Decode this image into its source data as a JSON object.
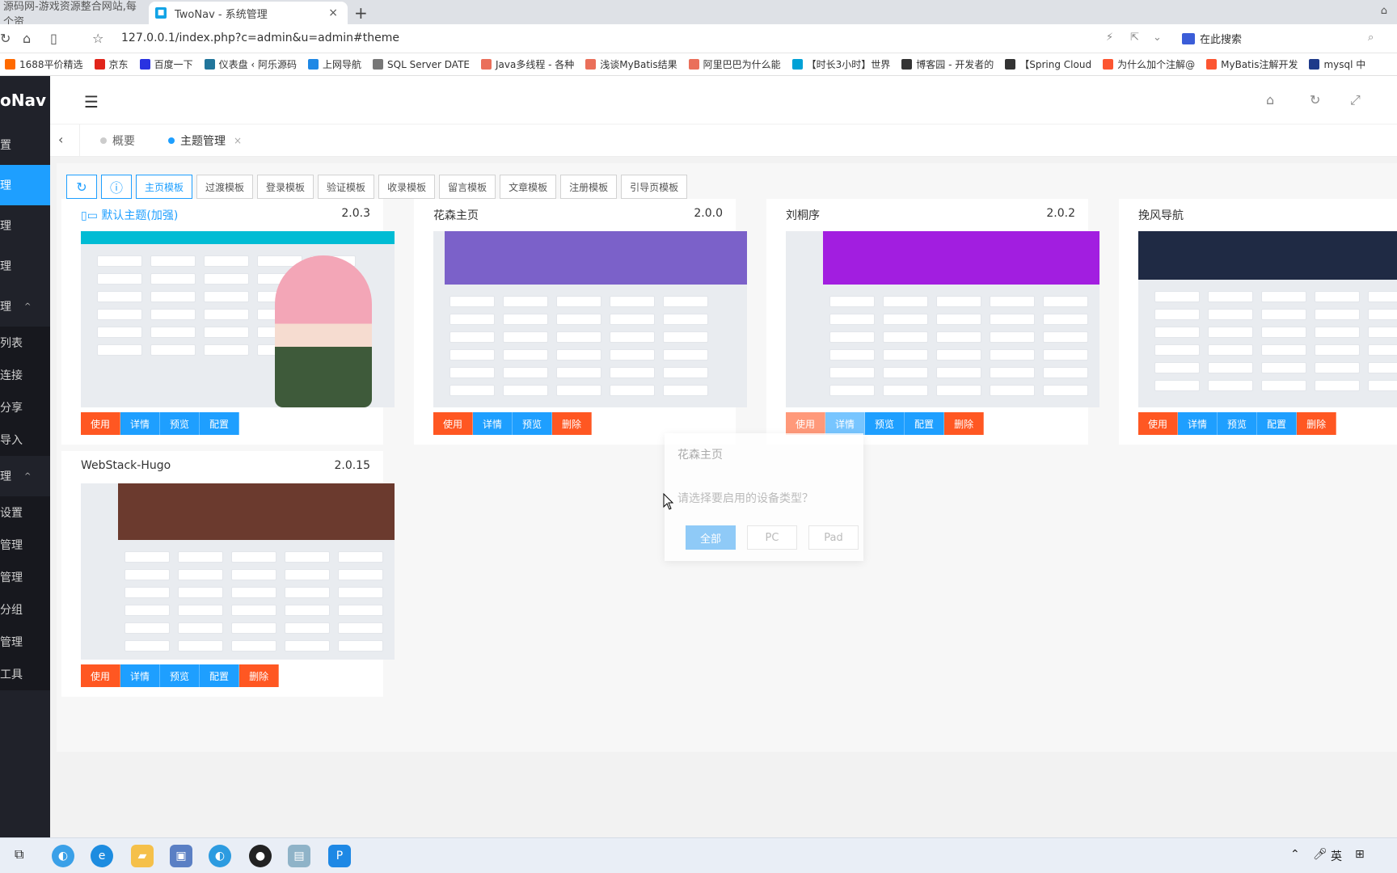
{
  "browser": {
    "tabs": [
      {
        "label": "源码网-游戏资源整合网站,每个资"
      },
      {
        "label": "TwoNav - 系统管理",
        "close": "×"
      }
    ],
    "new_tab": "+",
    "url": "127.0.0.1/index.php?c=admin&u=admin#theme",
    "search_label": "在此搜索",
    "bookmarks": [
      {
        "label": "1688平价精选",
        "color": "#ff6a00"
      },
      {
        "label": "京东",
        "color": "#e1251b"
      },
      {
        "label": "百度一下",
        "color": "#2932e1"
      },
      {
        "label": "仪表盘 ‹ 阿乐源码",
        "color": "#21759b"
      },
      {
        "label": "上网导航",
        "color": "#1e88e5"
      },
      {
        "label": "SQL Server DATE",
        "color": "#777777"
      },
      {
        "label": "Java多线程 - 各种",
        "color": "#ea6f5a"
      },
      {
        "label": "浅谈MyBatis结果",
        "color": "#ea6f5a"
      },
      {
        "label": "阿里巴巴为什么能",
        "color": "#ea6f5a"
      },
      {
        "label": "【时长3小时】世界",
        "color": "#00a1d6"
      },
      {
        "label": "博客园 - 开发者的",
        "color": "#333333"
      },
      {
        "label": "【Spring Cloud",
        "color": "#333333"
      },
      {
        "label": "为什么加个注解@",
        "color": "#fc5531"
      },
      {
        "label": "MyBatis注解开发",
        "color": "#fc5531"
      },
      {
        "label": "mysql 中",
        "color": "#1e3a8a"
      }
    ]
  },
  "sidebar": {
    "logo": "oNav",
    "items": [
      {
        "label": "置",
        "active": false
      },
      {
        "label": "理",
        "active": true
      },
      {
        "label": "理",
        "active": false
      },
      {
        "label": "理",
        "active": false
      },
      {
        "label": "理",
        "active": false,
        "arrow": "^"
      }
    ],
    "sub1": [
      "列表",
      "连接",
      "分享",
      "导入"
    ],
    "group2": {
      "label": "理",
      "arrow": "^"
    },
    "sub2": [
      "设置",
      "管理",
      "管理",
      "分组",
      "管理",
      "工具"
    ]
  },
  "page_tabs": [
    {
      "label": "概要",
      "active": false
    },
    {
      "label": "主题管理",
      "active": true,
      "close": "×"
    }
  ],
  "toolbar": {
    "buttons": [
      "主页模板",
      "过渡模板",
      "登录模板",
      "验证模板",
      "收录模板",
      "留言模板",
      "文章模板",
      "注册模板",
      "引导页模板"
    ]
  },
  "themes": [
    {
      "title": "默认主题(加强)",
      "version": "2.0.3",
      "actions": [
        "使用",
        "详情",
        "预览",
        "配置"
      ],
      "accent": "#00bcd4"
    },
    {
      "title": "花森主页",
      "version": "2.0.0",
      "actions": [
        "使用",
        "详情",
        "预览",
        "删除"
      ],
      "accent": "#7b61c9"
    },
    {
      "title": "刘桐序",
      "version": "2.0.2",
      "actions": [
        "使用",
        "详情",
        "预览",
        "配置",
        "删除"
      ],
      "accent": "#a21ee0"
    },
    {
      "title": "挽风导航",
      "version": "",
      "actions": [
        "使用",
        "详情",
        "预览",
        "配置",
        "删除"
      ],
      "accent": "#1f2a44"
    },
    {
      "title": "WebStack-Hugo",
      "version": "2.0.15",
      "actions": [
        "使用",
        "详情",
        "预览",
        "配置",
        "删除"
      ],
      "accent": "#6b3a2e"
    }
  ],
  "modal": {
    "title": "花森主页",
    "question": "请选择要启用的设备类型？",
    "buttons": [
      "全部",
      "PC",
      "Pad"
    ]
  },
  "taskbar": {
    "tray_ime": "英"
  }
}
